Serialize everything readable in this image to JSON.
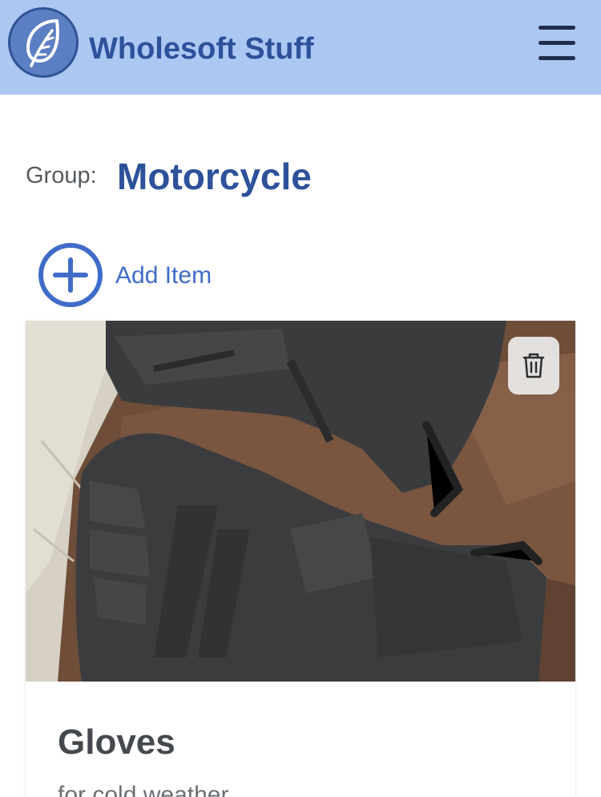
{
  "header": {
    "logo_icon": "leaf-icon",
    "brand": "Wholesoft Stuff",
    "menu_icon": "hamburger-menu-icon",
    "background_color": "#adc7f3",
    "brand_color": "#2d519a"
  },
  "group": {
    "label": "Group:",
    "name": "Motorcycle"
  },
  "add_item": {
    "icon": "plus-circle-icon",
    "label": "Add Item",
    "color": "#3f6cc9"
  },
  "items": [
    {
      "photo": "gloves-photo",
      "delete_icon": "trash-icon",
      "title": "Gloves",
      "description": "for cold weather"
    }
  ]
}
